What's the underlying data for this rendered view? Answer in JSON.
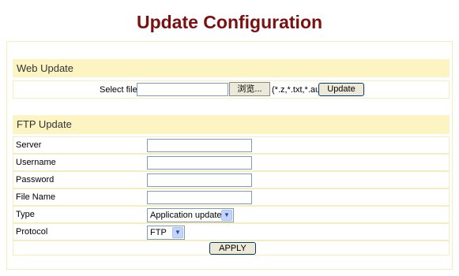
{
  "page": {
    "title": "Update Configuration"
  },
  "web_update": {
    "header": "Web Update",
    "select_file_label": "Select file",
    "file_value": "",
    "browse_label": "浏览...",
    "extensions_hint": "(*.z,*.txt,*.au)",
    "update_label": "Update"
  },
  "ftp_update": {
    "header": "FTP Update",
    "fields": [
      {
        "label": "Server",
        "value": ""
      },
      {
        "label": "Username",
        "value": ""
      },
      {
        "label": "Password",
        "value": ""
      },
      {
        "label": "File Name",
        "value": ""
      }
    ],
    "type_label": "Type",
    "type_selected": "Application update",
    "protocol_label": "Protocol",
    "protocol_selected": "FTP",
    "apply_label": "APPLY"
  }
}
